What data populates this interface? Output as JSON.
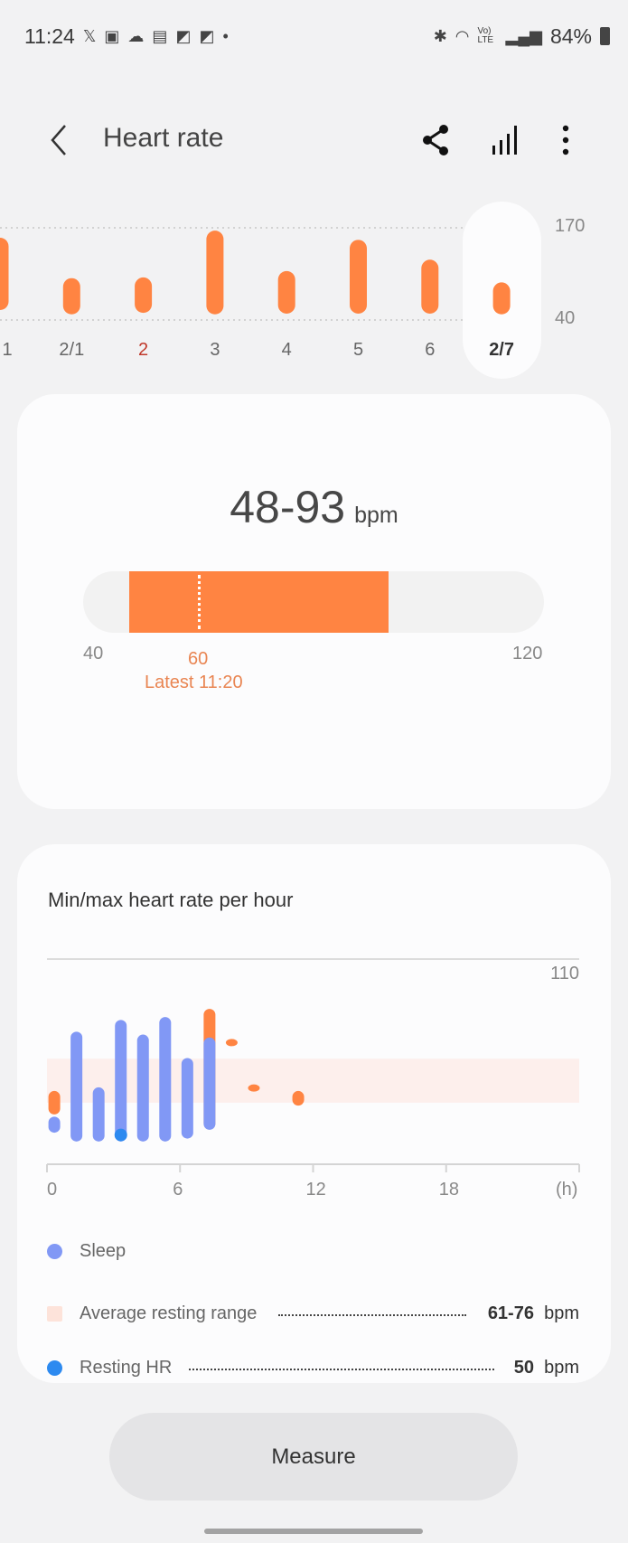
{
  "status_bar": {
    "time": "11:24",
    "battery": "84%",
    "left_icons": [
      "x-icon",
      "gallery-icon",
      "cloud-icon",
      "ge-icon",
      "ok-icon",
      "ok-icon",
      "dot-icon"
    ],
    "right_icons": [
      "bluetooth-icon",
      "wifi-icon",
      "volte-icon",
      "signal-icon",
      "battery-icon"
    ],
    "volte": "Vo) LTE"
  },
  "header": {
    "title": "Heart rate",
    "icons": [
      "back-icon",
      "share-icon",
      "trends-icon",
      "more-icon"
    ]
  },
  "summary": {
    "range": "48-93",
    "unit": "bpm",
    "scale_min": "40",
    "scale_max": "120",
    "range_min": 48,
    "range_max": 93,
    "latest_value": "60",
    "latest_label": "Latest 11:20"
  },
  "hourly": {
    "title": "Min/max heart rate per hour",
    "legend": {
      "sleep": "Sleep",
      "resting_range_label": "Average resting range",
      "resting_range_value": "61-76",
      "resting_hr_label": "Resting HR",
      "resting_hr_value": "50",
      "unit": "bpm"
    }
  },
  "measure_button": "Measure",
  "colors": {
    "accent": "#ff8442",
    "sleep": "#8198f5",
    "resting_hr": "#2d8af0",
    "resting_band": "#fdefec",
    "weekend": "#c0392b"
  },
  "chart_data": [
    {
      "type": "bar",
      "subtype": "range",
      "categories": [
        "1",
        "2/1",
        "2",
        "3",
        "4",
        "5",
        "6",
        "2/7"
      ],
      "highlight_weekend": "2",
      "selected": "2/7",
      "min": [
        54,
        48,
        50,
        48,
        49,
        49,
        49,
        48
      ],
      "max": [
        156,
        99,
        100,
        166,
        109,
        153,
        125,
        93
      ],
      "y_ticks": [
        "170",
        "40"
      ],
      "ylim": [
        40,
        170
      ],
      "grid": true
    },
    {
      "type": "bar",
      "subtype": "range",
      "x_ticks": [
        "0",
        "6",
        "12",
        "18",
        "(h)"
      ],
      "xlim": [
        0,
        24
      ],
      "ylim": [
        40,
        110
      ],
      "y_ticks": [
        "110"
      ],
      "series": [
        {
          "name": "Sleep",
          "hours": [
            0,
            1,
            2,
            3,
            4,
            5,
            6,
            7
          ],
          "min": [
            52,
            49,
            49,
            49,
            49,
            49,
            50,
            53
          ],
          "max": [
            55,
            84,
            65,
            88,
            83,
            89,
            75,
            82
          ]
        },
        {
          "hours": [
            0,
            7,
            8,
            9,
            11
          ],
          "min": [
            57,
            52,
            81,
            66,
            60
          ],
          "max": [
            65,
            93,
            82,
            66,
            65
          ]
        }
      ],
      "resting_range": [
        61,
        76
      ],
      "resting_hr": {
        "hour": 3,
        "value": 50
      }
    }
  ]
}
